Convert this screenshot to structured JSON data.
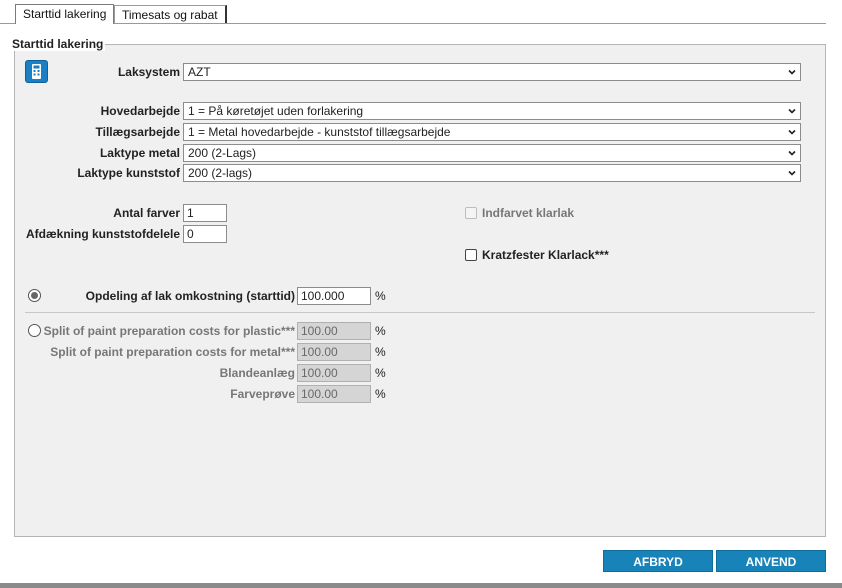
{
  "tabs": [
    {
      "label": "Starttid lakering"
    },
    {
      "label": "Timesats og rabat"
    }
  ],
  "group": {
    "legend": "Starttid lakering"
  },
  "fields": {
    "laksystem": {
      "label": "Laksystem",
      "value": "AZT"
    },
    "hovedarbejde": {
      "label": "Hovedarbejde",
      "value": "1 = På køretøjet uden forlakering"
    },
    "tillaegsarbejde": {
      "label": "Tillægsarbejde",
      "value": "1 = Metal hovedarbejde - kunststof tillægsarbejde"
    },
    "laktype_metal": {
      "label": "Laktype metal",
      "value": "200 (2-Lags)"
    },
    "laktype_kunststof": {
      "label": "Laktype kunststof",
      "value": "200 (2-lags)"
    },
    "antal_farver": {
      "label": "Antal farver",
      "value": "1"
    },
    "afdaekning": {
      "label": "Afdækning kunststofdelele",
      "value": "0"
    }
  },
  "checkboxes": {
    "indfarvet": {
      "label": "Indfarvet klarlak",
      "checked": false,
      "disabled": true
    },
    "kratzfester": {
      "label": "Kratzfester Klarlack***",
      "checked": false,
      "disabled": false
    }
  },
  "opdeling": {
    "label": "Opdeling af lak omkostning (starttid)",
    "value": "100.000",
    "unit": "%",
    "selected": true
  },
  "split": {
    "plastic": {
      "label": "Split of paint preparation costs for plastic***",
      "value": "100.00",
      "unit": "%",
      "selected": false
    },
    "metal": {
      "label": "Split of paint preparation costs for metal***",
      "value": "100.00",
      "unit": "%"
    },
    "blandeanlaeg": {
      "label": "Blandeanlæg",
      "value": "100.00",
      "unit": "%"
    },
    "farveproeve": {
      "label": "Farveprøve",
      "value": "100.00",
      "unit": "%"
    }
  },
  "buttons": {
    "cancel": "AFBRYD",
    "apply": "ANVEND"
  },
  "colors": {
    "button": "#1783b8",
    "icon": "#1a7fc4",
    "panel": "#f0f0f0"
  },
  "icons": {
    "calculator": "calculator-icon",
    "dropdown": "chevron-down-icon"
  }
}
